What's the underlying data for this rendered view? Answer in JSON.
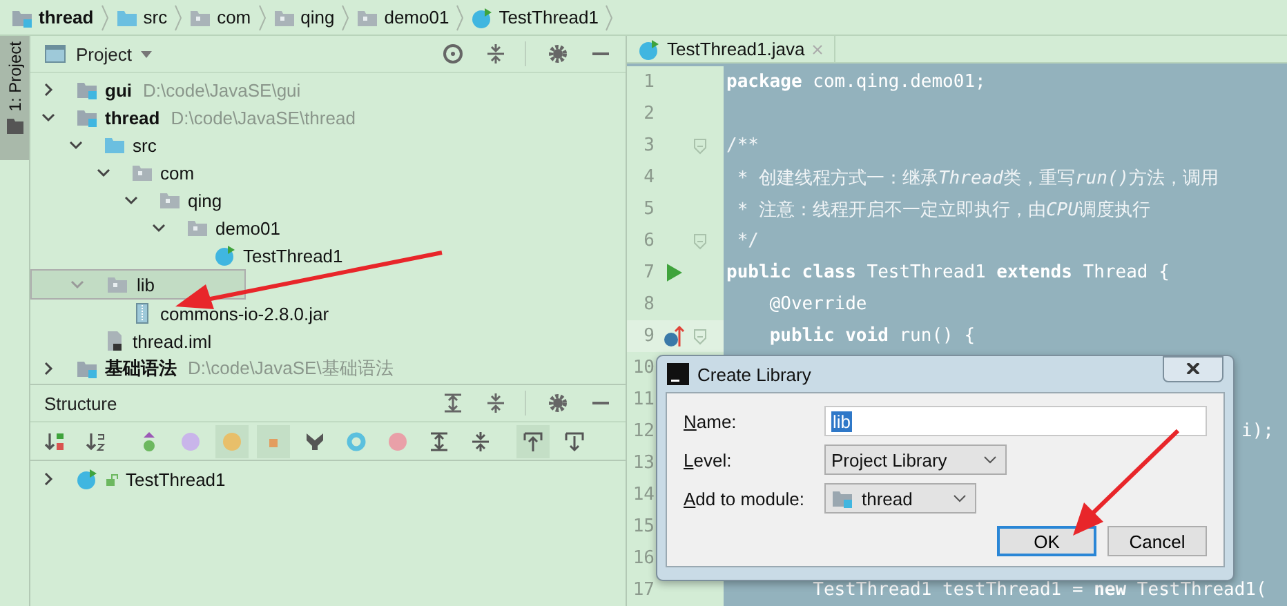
{
  "breadcrumb": [
    {
      "label": "thread",
      "kind": "module",
      "bold": true
    },
    {
      "label": "src",
      "kind": "source",
      "bold": false
    },
    {
      "label": "com",
      "kind": "package",
      "bold": false
    },
    {
      "label": "qing",
      "kind": "package",
      "bold": false
    },
    {
      "label": "demo01",
      "kind": "package",
      "bold": false
    },
    {
      "label": "TestThread1",
      "kind": "class",
      "bold": false
    }
  ],
  "side_tab": {
    "label": "1: Project",
    "selected": true
  },
  "project": {
    "title": "Project",
    "tree": [
      {
        "label": "gui",
        "path": "D:\\code\\JavaSE\\gui",
        "kind": "module",
        "bold": true,
        "expanded": false,
        "selected": false
      },
      {
        "label": "thread",
        "path": "D:\\code\\JavaSE\\thread",
        "kind": "module",
        "bold": true,
        "expanded": true,
        "selected": false,
        "children": [
          {
            "label": "src",
            "kind": "source",
            "expanded": true,
            "selected": false,
            "children": [
              {
                "label": "com",
                "kind": "package",
                "expanded": true,
                "selected": false,
                "children": [
                  {
                    "label": "qing",
                    "kind": "package",
                    "expanded": true,
                    "selected": false,
                    "children": [
                      {
                        "label": "demo01",
                        "kind": "package",
                        "expanded": true,
                        "selected": false,
                        "children": [
                          {
                            "label": "TestThread1",
                            "kind": "class",
                            "selected": false
                          }
                        ]
                      }
                    ]
                  }
                ]
              }
            ]
          },
          {
            "label": "lib",
            "kind": "package",
            "expanded": true,
            "selected": true,
            "children": [
              {
                "label": "commons-io-2.8.0.jar",
                "kind": "jar",
                "selected": false
              }
            ]
          },
          {
            "label": "thread.iml",
            "kind": "iml",
            "selected": false
          }
        ]
      },
      {
        "label": "基础语法",
        "path": "D:\\code\\JavaSE\\基础语法",
        "kind": "module",
        "bold": true,
        "expanded": false,
        "selected": false
      }
    ]
  },
  "structure": {
    "title": "Structure",
    "tree": [
      {
        "label": "TestThread1",
        "kind": "class",
        "expanded": false
      }
    ]
  },
  "editor": {
    "tab": "TestThread1.java",
    "lines": [
      {
        "n": "1",
        "text": "**package** com.qing.demo01;"
      },
      {
        "n": "2"
      },
      {
        "n": "3",
        "text": "/**",
        "fold": true,
        "kind": "comment"
      },
      {
        "n": "4",
        "kind": "comment",
        "parts": [
          {
            "text": " * 创建线程方式一：继承",
            "italic": false
          },
          {
            "text": "Thread",
            "italic": true
          },
          {
            "text": "类，重写",
            "italic": false
          },
          {
            "text": "run()",
            "italic": true
          },
          {
            "text": "方法，调用",
            "italic": false
          }
        ]
      },
      {
        "n": "5",
        "kind": "comment",
        "parts": [
          {
            "text": " * 注意：线程开启不一定立即执行，由",
            "italic": false
          },
          {
            "text": "CPU",
            "italic": true
          },
          {
            "text": "调度执行",
            "italic": false
          }
        ]
      },
      {
        "n": "6",
        "text": " */",
        "fold": true,
        "kind": "comment"
      },
      {
        "n": "7",
        "text": "**public class** TestThread1 **extends** Thread {",
        "run": true
      },
      {
        "n": "8",
        "text": "    @Override"
      },
      {
        "n": "9",
        "text": "    **public void** run() {",
        "override": true,
        "fold": true,
        "current": true
      },
      {
        "n": "10"
      },
      {
        "n": "11"
      },
      {
        "n": "12",
        "text": "i);",
        "kind": "tail"
      },
      {
        "n": "13"
      },
      {
        "n": "14"
      },
      {
        "n": "15"
      },
      {
        "n": "16"
      },
      {
        "n": "17",
        "text": "        TestThread1 testThread1 = **new** TestThread1("
      }
    ]
  },
  "dialog": {
    "title": "Create Library",
    "fields": [
      {
        "label": "Name:",
        "kind": "input",
        "value": "lib"
      },
      {
        "label": "Level:",
        "kind": "select",
        "value": "Project Library"
      },
      {
        "label": "Add to module:",
        "kind": "module-select",
        "value": "thread"
      }
    ],
    "buttons": [
      {
        "label": "OK",
        "default": true
      },
      {
        "label": "Cancel",
        "default": false
      }
    ]
  }
}
